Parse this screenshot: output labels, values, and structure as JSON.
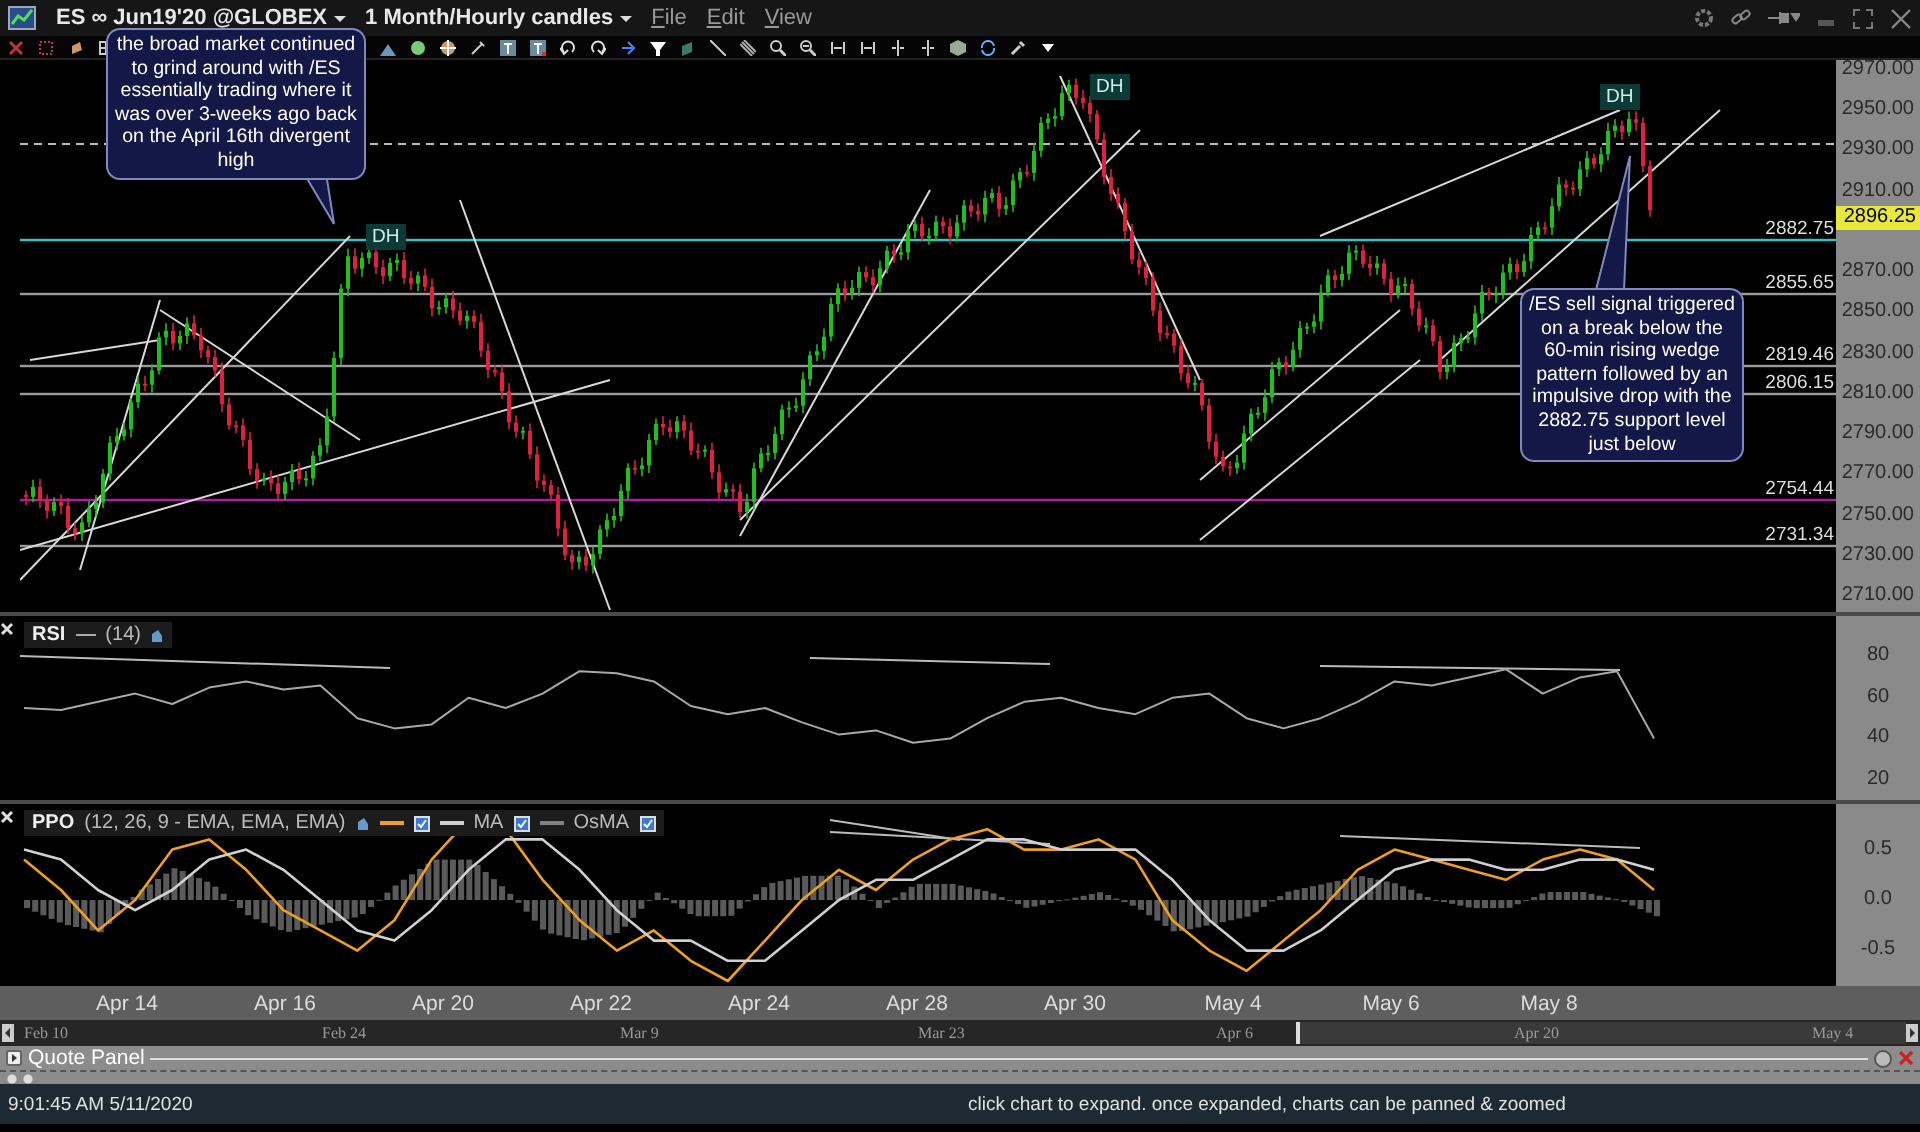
{
  "title_bar": {
    "symbol": "ES ∞ Jun19'20 @GLOBEX",
    "timeframe": "1 Month/Hourly candles",
    "menus": [
      "File",
      "Edit",
      "View"
    ]
  },
  "price_chart": {
    "axis_labels": [
      "2970.00",
      "2950.00",
      "2930.00",
      "2910.00",
      "2870.00",
      "2850.00",
      "2830.00",
      "2810.00",
      "2790.00",
      "2770.00",
      "2750.00",
      "2730.00",
      "2710.00"
    ],
    "current_price": "2896.25",
    "levels": [
      {
        "label": "2882.75",
        "color": "#2ec8c8"
      },
      {
        "label": "2855.65",
        "color": "#9a9a9a"
      },
      {
        "label": "2819.46",
        "color": "#9a9a9a"
      },
      {
        "label": "2806.15",
        "color": "#9a9a9a"
      },
      {
        "label": "2754.44",
        "color": "#b01cb0"
      },
      {
        "label": "2731.34",
        "color": "#9a9a9a"
      }
    ],
    "markers": [
      "DH",
      "DH",
      "DH"
    ]
  },
  "callouts": [
    "the broad market continued to grind around with /ES essentially trading where it was over 3-weeks ago back on the April 16th divergent high",
    "/ES sell signal triggered on a break below the 60-min rising wedge pattern followed by an impulsive drop with the 2882.75 support level just below"
  ],
  "rsi_panel": {
    "name": "RSI",
    "params": "(14)",
    "axis_labels": [
      "80",
      "60",
      "40",
      "20"
    ]
  },
  "ppo_panel": {
    "name": "PPO",
    "params": "(12, 26, 9 - EMA, EMA, EMA)",
    "legend": [
      {
        "color": "#f0a020",
        "checked": true
      },
      {
        "label": "MA",
        "color": "#d0d0d0",
        "checked": true
      },
      {
        "label": "OsMA",
        "color": "#808080",
        "checked": true
      }
    ],
    "axis_labels": [
      "0.5",
      "0.0",
      "-0.5"
    ]
  },
  "date_axis": [
    "Apr 14",
    "Apr 16",
    "Apr 20",
    "Apr 22",
    "Apr 24",
    "Apr 28",
    "Apr 30",
    "May 4",
    "May 6",
    "May 8"
  ],
  "scroller_dates": [
    "Feb 10",
    "Feb 24",
    "Mar 9",
    "Mar 23",
    "Apr 6",
    "Apr 20",
    "May 4"
  ],
  "quote_panel": {
    "title": "Quote Panel"
  },
  "status_bar": {
    "time": "9:01:45 AM 5/11/2020",
    "message": "click chart to expand. once expanded, charts can be panned & zoomed"
  }
}
